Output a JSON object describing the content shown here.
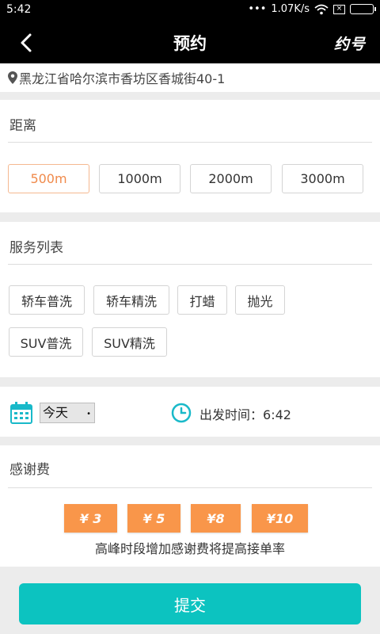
{
  "status_bar": {
    "time": "5:42",
    "dots": "•••",
    "network_speed": "1.07K/s",
    "wifi_icon": "wifi-icon",
    "sim_icon": "sim-x-icon",
    "battery_icon": "battery-icon"
  },
  "nav": {
    "title": "预约",
    "back_icon": "back-arrow-icon",
    "logo_text": "约号"
  },
  "address": {
    "icon": "location-pin-icon",
    "text": "黑龙江省哈尔滨市香坊区香城街40-1"
  },
  "distance": {
    "heading": "距离",
    "options": [
      "500m",
      "1000m",
      "2000m",
      "3000m"
    ],
    "selected": "500m"
  },
  "services": {
    "heading": "服务列表",
    "items": [
      "轿车普洗",
      "轿车精洗",
      "打蜡",
      "抛光",
      "SUV普洗",
      "SUV精洗"
    ]
  },
  "schedule": {
    "calendar_icon": "calendar-icon",
    "day_value": "今天",
    "clock_icon": "clock-icon",
    "depart_label": "出发时间：",
    "depart_time": "6:42"
  },
  "thanks_fee": {
    "heading": "感谢费",
    "options": [
      "¥ 3",
      "¥ 5",
      "¥8",
      "¥10"
    ],
    "note": "高峰时段增加感谢费将提高接单率"
  },
  "submit_label": "提交",
  "colors": {
    "accent_teal": "#0cc3c0",
    "accent_orange": "#f9964a",
    "selected_orange": "#f08a4b"
  }
}
